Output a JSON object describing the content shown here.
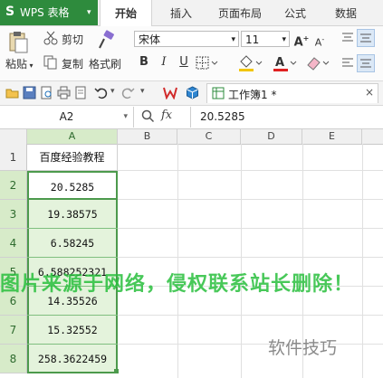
{
  "app": {
    "logo_letter": "S",
    "title": "WPS 表格",
    "menu_arrow": "▾"
  },
  "tabs": [
    "开始",
    "插入",
    "页面布局",
    "公式",
    "数据"
  ],
  "ribbon": {
    "paste": "粘贴",
    "cut": "剪切",
    "copy": "复制",
    "format_painter": "格式刷",
    "font_name": "宋体",
    "font_size": "11",
    "grow": "A",
    "shrink": "A",
    "bold": "B",
    "italic": "I",
    "underline": "U"
  },
  "document": {
    "tab_title": "工作簿1 *"
  },
  "formula_bar": {
    "cell_ref": "A2",
    "fx": "fx",
    "value": "20.5285"
  },
  "columns": [
    "A",
    "B",
    "C",
    "D",
    "E"
  ],
  "rows": [
    "1",
    "2",
    "3",
    "4",
    "5",
    "6",
    "7",
    "8"
  ],
  "cells_a": [
    "百度经验教程",
    "20.5285",
    "19.38575",
    "6.58245",
    "6.588252321",
    "14.35526",
    "15.32552",
    "258.3622459"
  ],
  "watermark": {
    "text": "图片来源于网络，侵权联系站长删除！",
    "brand": "软件技巧"
  },
  "colors": {
    "wps_green": "#2e8b3d",
    "selection": "#e4f3dc",
    "selection_border": "#4c9a4c"
  }
}
